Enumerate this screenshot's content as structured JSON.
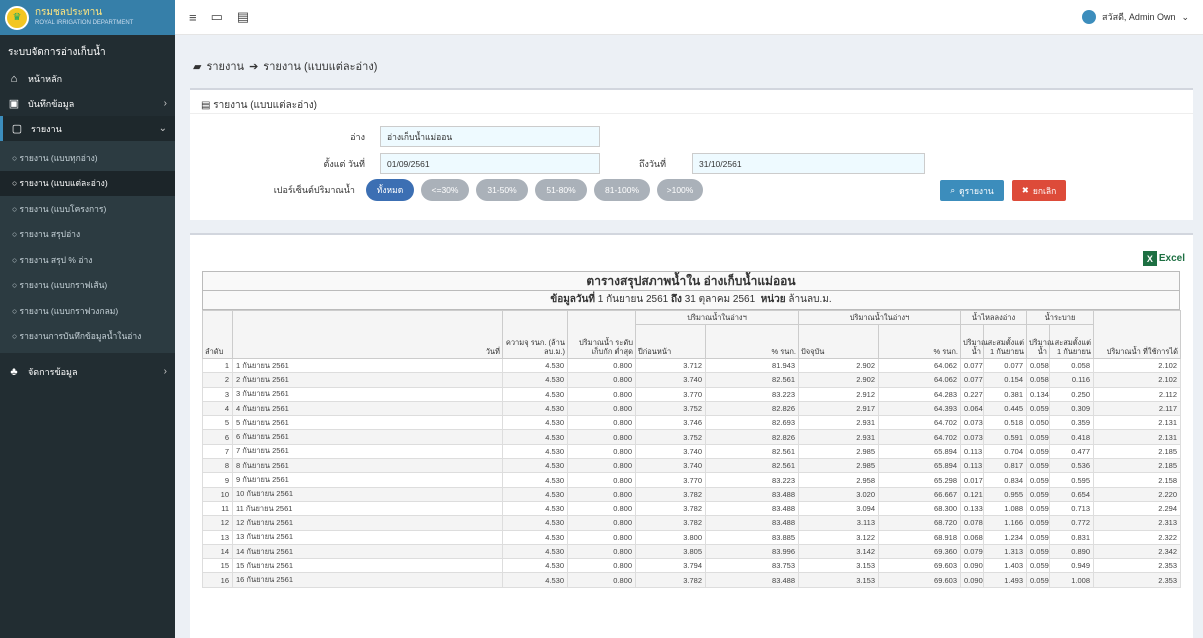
{
  "app": {
    "logo_line1": "กรมชลประทาน",
    "logo_line2": "ROYAL IRRIGATION DEPARTMENT",
    "system_title": "ระบบจัดการอ่างเก็บน้ำ"
  },
  "sidebar": {
    "items": [
      {
        "label": "หน้าหลัก",
        "icon": "home-icon"
      },
      {
        "label": "บันทึกข้อมูล",
        "icon": "save-icon"
      },
      {
        "label": "รายงาน",
        "icon": "file-icon"
      }
    ],
    "report_sub": [
      "รายงาน (แบบทุกอ่าง)",
      "รายงาน (แบบแต่ละอ่าง)",
      "รายงาน (แบบโครงการ)",
      "รายงาน สรุปอ่าง",
      "รายงาน สรุป % อ่าง",
      "รายงาน (แบบกราฟเส้น)",
      "รายงาน (แบบกราฟวงกลม)",
      "รายงานการบันทึกข้อมูลน้ำในอ่าง"
    ],
    "manage": "จัดการข้อมูล"
  },
  "topbar": {
    "user": "สวัสดี, Admin Own"
  },
  "breadcrumb": {
    "a": "รายงาน",
    "arrow": "➔",
    "b": "รายงาน (แบบแต่ละอ่าง)"
  },
  "filter": {
    "title": "รายงาน (แบบแต่ละอ่าง)",
    "dam_label": "อ่าง",
    "dam_value": "อ่างเก็บน้ำแม่ออน",
    "from_label": "ตั้งแต่ วันที่",
    "from_value": "01/09/2561",
    "to_label": "ถึงวันที่",
    "to_value": "31/10/2561",
    "percent_label": "เปอร์เซ็นต์ปริมาณน้ำ",
    "pills": [
      "ทั้งหมด",
      "<=30%",
      "31-50%",
      "51-80%",
      "81-100%",
      ">100%"
    ],
    "search_btn": "ดูรายงาน",
    "cancel_btn": "ยกเลิก"
  },
  "report": {
    "excel": "Excel",
    "title": "ตารางสรุปสภาพน้ำใน อ่างเก็บน้ำแม่ออน",
    "sub_prefix": "ข้อมูลวันที่",
    "sub_from": "1 กันยายน 2561",
    "sub_to_word": "ถึง",
    "sub_to": "31 ตุลาคม 2561",
    "unit_word": "หน่วย",
    "unit": "ล้านลบ.ม.",
    "headers": {
      "no": "ลำดับ",
      "date": "วันที่",
      "capacity": "ความจุ รนก. (ล้าน ลบ.ม.)",
      "min_storage": "ปริมาณน้ำ ระดับเก็บกัก ต่ำสุด",
      "last_year_group": "ปริมาณน้ำในอ่างฯ",
      "last_year": "ปีก่อนหน้า",
      "last_year_pct": "% รนก.",
      "current_group": "ปริมาณน้ำในอ่างฯ",
      "current": "ปัจจุบัน",
      "current_pct": "% รนก.",
      "inflow_group": "น้ำไหลลงอ่าง",
      "inflow": "ปริมาณ น้ำ",
      "inflow_acc": "สะสมตั้งแต่ 1 กันยายน",
      "outflow_group": "น้ำระบาย",
      "outflow": "ปริมาณ น้ำ",
      "outflow_acc": "สะสมตั้งแต่ 1 กันยายน",
      "usable": "ปริมาณน้ำ ที่ใช้การได้"
    },
    "rows": [
      [
        "1",
        "1 กันยายน 2561",
        "4.530",
        "0.800",
        "3.712",
        "81.943",
        "2.902",
        "64.062",
        "0.077",
        "0.077",
        "0.058",
        "0.058",
        "2.102"
      ],
      [
        "2",
        "2 กันยายน 2561",
        "4.530",
        "0.800",
        "3.740",
        "82.561",
        "2.902",
        "64.062",
        "0.077",
        "0.154",
        "0.058",
        "0.116",
        "2.102"
      ],
      [
        "3",
        "3 กันยายน 2561",
        "4.530",
        "0.800",
        "3.770",
        "83.223",
        "2.912",
        "64.283",
        "0.227",
        "0.381",
        "0.134",
        "0.250",
        "2.112"
      ],
      [
        "4",
        "4 กันยายน 2561",
        "4.530",
        "0.800",
        "3.752",
        "82.826",
        "2.917",
        "64.393",
        "0.064",
        "0.445",
        "0.059",
        "0.309",
        "2.117"
      ],
      [
        "5",
        "5 กันยายน 2561",
        "4.530",
        "0.800",
        "3.746",
        "82.693",
        "2.931",
        "64.702",
        "0.073",
        "0.518",
        "0.050",
        "0.359",
        "2.131"
      ],
      [
        "6",
        "6 กันยายน 2561",
        "4.530",
        "0.800",
        "3.752",
        "82.826",
        "2.931",
        "64.702",
        "0.073",
        "0.591",
        "0.059",
        "0.418",
        "2.131"
      ],
      [
        "7",
        "7 กันยายน 2561",
        "4.530",
        "0.800",
        "3.740",
        "82.561",
        "2.985",
        "65.894",
        "0.113",
        "0.704",
        "0.059",
        "0.477",
        "2.185"
      ],
      [
        "8",
        "8 กันยายน 2561",
        "4.530",
        "0.800",
        "3.740",
        "82.561",
        "2.985",
        "65.894",
        "0.113",
        "0.817",
        "0.059",
        "0.536",
        "2.185"
      ],
      [
        "9",
        "9 กันยายน 2561",
        "4.530",
        "0.800",
        "3.770",
        "83.223",
        "2.958",
        "65.298",
        "0.017",
        "0.834",
        "0.059",
        "0.595",
        "2.158"
      ],
      [
        "10",
        "10 กันยายน 2561",
        "4.530",
        "0.800",
        "3.782",
        "83.488",
        "3.020",
        "66.667",
        "0.121",
        "0.955",
        "0.059",
        "0.654",
        "2.220"
      ],
      [
        "11",
        "11 กันยายน 2561",
        "4.530",
        "0.800",
        "3.782",
        "83.488",
        "3.094",
        "68.300",
        "0.133",
        "1.088",
        "0.059",
        "0.713",
        "2.294"
      ],
      [
        "12",
        "12 กันยายน 2561",
        "4.530",
        "0.800",
        "3.782",
        "83.488",
        "3.113",
        "68.720",
        "0.078",
        "1.166",
        "0.059",
        "0.772",
        "2.313"
      ],
      [
        "13",
        "13 กันยายน 2561",
        "4.530",
        "0.800",
        "3.800",
        "83.885",
        "3.122",
        "68.918",
        "0.068",
        "1.234",
        "0.059",
        "0.831",
        "2.322"
      ],
      [
        "14",
        "14 กันยายน 2561",
        "4.530",
        "0.800",
        "3.805",
        "83.996",
        "3.142",
        "69.360",
        "0.079",
        "1.313",
        "0.059",
        "0.890",
        "2.342"
      ],
      [
        "15",
        "15 กันยายน 2561",
        "4.530",
        "0.800",
        "3.794",
        "83.753",
        "3.153",
        "69.603",
        "0.090",
        "1.403",
        "0.059",
        "0.949",
        "2.353"
      ],
      [
        "16",
        "16 กันยายน 2561",
        "4.530",
        "0.800",
        "3.782",
        "83.488",
        "3.153",
        "69.603",
        "0.090",
        "1.493",
        "0.059",
        "1.008",
        "2.353"
      ]
    ]
  }
}
